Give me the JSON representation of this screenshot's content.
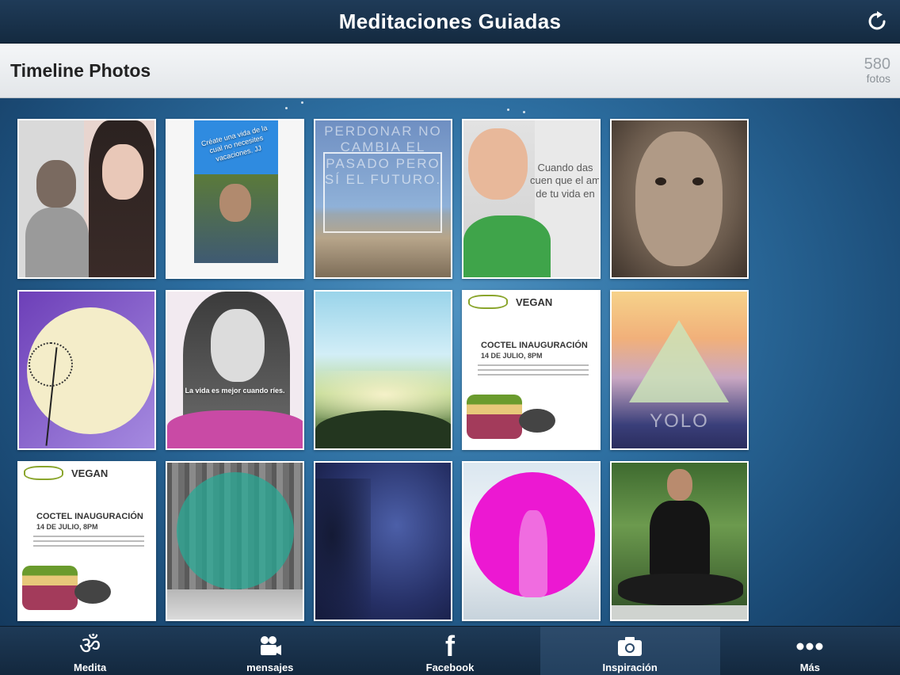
{
  "header": {
    "title": "Meditaciones Guiadas",
    "refresh_icon": "refresh-icon"
  },
  "album": {
    "title": "Timeline Photos",
    "count": "580",
    "count_unit": "fotos"
  },
  "photos": [
    {
      "id": 1,
      "caption": ""
    },
    {
      "id": 2,
      "caption": "Créate una vida de la cual no necesites vacaciones. JJ"
    },
    {
      "id": 3,
      "caption": "PERDONAR NO CAMBIA EL PASADO PERO SÍ EL FUTURO."
    },
    {
      "id": 4,
      "caption": "Cuando das cuen que el am de tu vida en"
    },
    {
      "id": 5,
      "caption": ""
    },
    {
      "id": 6,
      "caption": ""
    },
    {
      "id": 7,
      "caption": "La vida es mejor cuando ríes."
    },
    {
      "id": 8,
      "caption": ""
    },
    {
      "id": 9,
      "vegan_logo": "VEGAN",
      "event_title": "COCTEL INAUGURACIÓN",
      "event_date": "14 DE JULIO, 8PM"
    },
    {
      "id": 10,
      "overlay": "YOLO"
    },
    {
      "id": 11,
      "vegan_logo": "VEGAN",
      "event_title": "COCTEL INAUGURACIÓN",
      "event_date": "14 DE JULIO, 8PM"
    },
    {
      "id": 12,
      "caption": ""
    },
    {
      "id": 13,
      "caption": ""
    },
    {
      "id": 14,
      "caption": ""
    },
    {
      "id": 15,
      "caption": ""
    }
  ],
  "nav": [
    {
      "label": "Medita",
      "icon": "om-icon",
      "active": false
    },
    {
      "label": "mensajes",
      "icon": "video-camera-icon",
      "active": false
    },
    {
      "label": "Facebook",
      "icon": "facebook-icon",
      "active": false
    },
    {
      "label": "Inspiración",
      "icon": "camera-icon",
      "active": true
    },
    {
      "label": "Más",
      "icon": "more-dots-icon",
      "active": false
    }
  ],
  "colors": {
    "bar": "#1a3450",
    "active_tab": "#2a4868",
    "background": "#2c6d9f"
  }
}
